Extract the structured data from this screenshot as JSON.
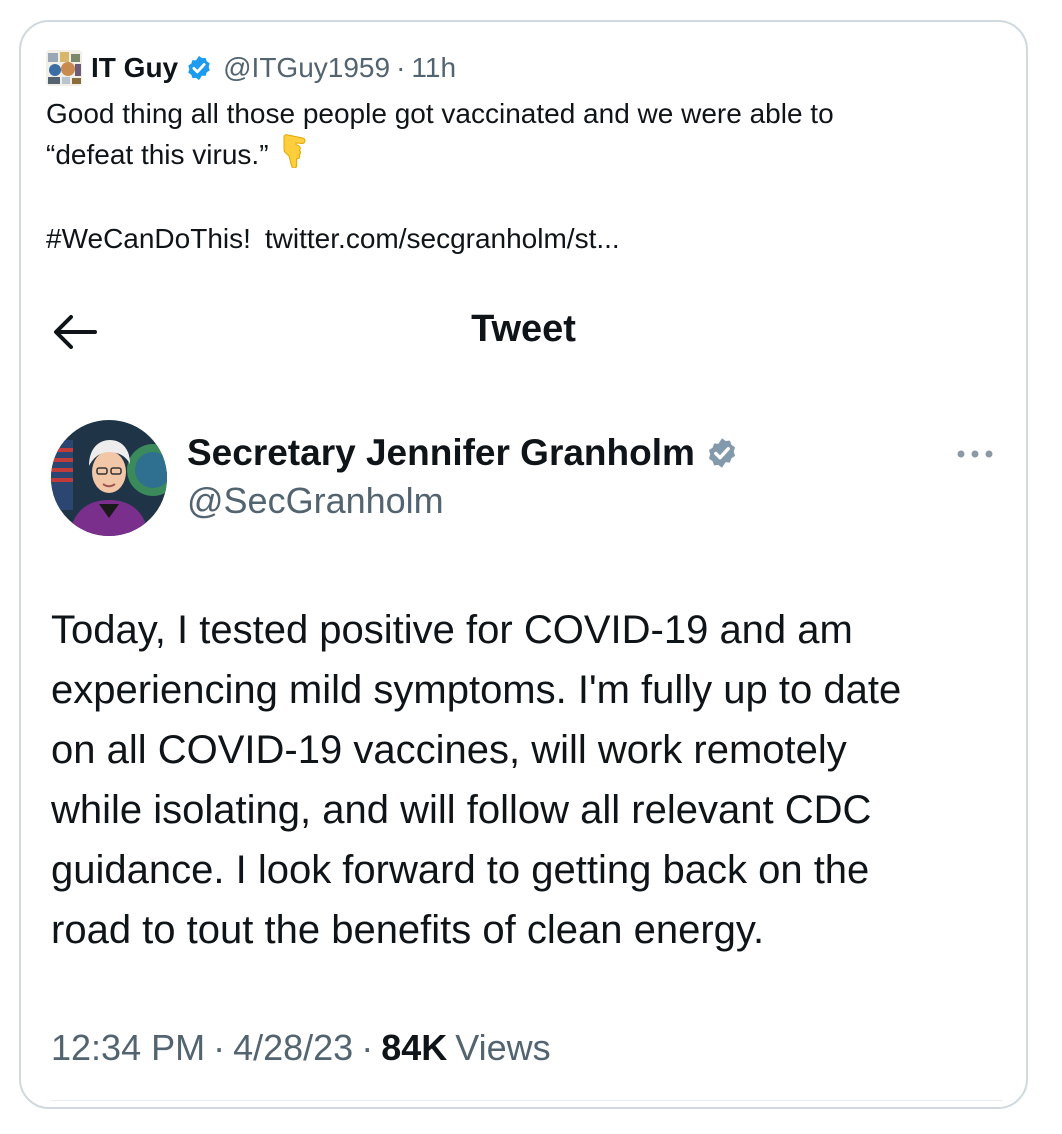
{
  "quote": {
    "author_name": "IT Guy",
    "author_handle": "@ITGuy1959",
    "separator": "·",
    "time_ago": "11h",
    "text_line1": "Good thing all those people got vaccinated and we were able to",
    "text_line2": "“defeat this virus.”",
    "emoji": "backhand-index-pointing-down",
    "hashtag": "#WeCanDoThis!",
    "link": "twitter.com/secgranholm/st..."
  },
  "embedded": {
    "nav_title": "Tweet",
    "author_name": "Secretary Jennifer Granholm",
    "author_handle": "@SecGranholm",
    "body_lines": [
      "Today, I tested positive for COVID-19 and am",
      "experiencing mild symptoms. I'm fully up to date",
      "on all COVID-19 vaccines, will work remotely",
      "while isolating, and will follow all relevant CDC",
      "guidance. I look forward to getting back on the",
      "road to tout the benefits of clean energy."
    ],
    "time": "12:34 PM",
    "separator": "·",
    "date": "4/28/23",
    "views_count": "84K",
    "views_label": "Views"
  },
  "colors": {
    "verified_blue": "#1d9bf0",
    "verified_gray": "#829aab",
    "secondary_text": "#536471",
    "primary_text": "#0f1419",
    "border": "#cfd9de"
  }
}
